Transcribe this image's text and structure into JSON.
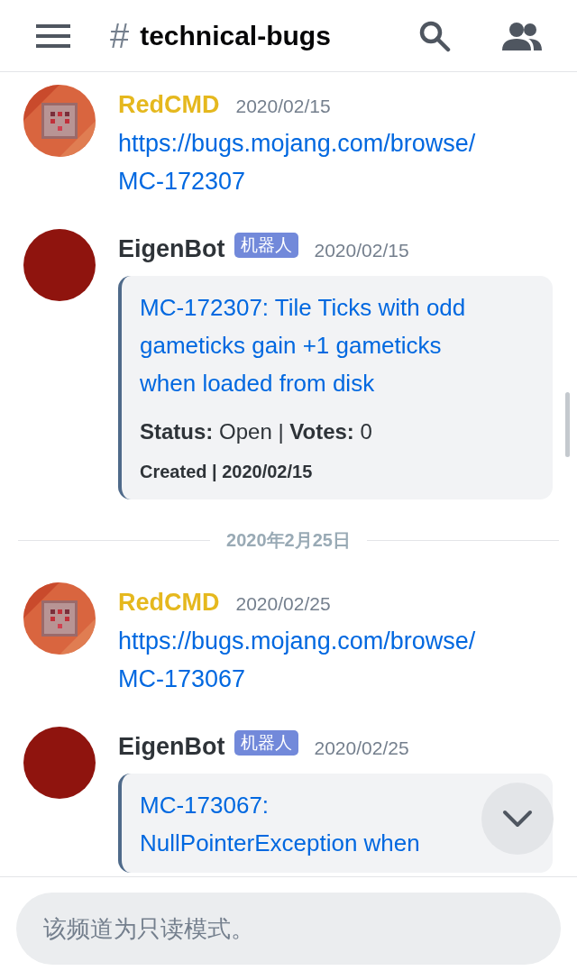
{
  "header": {
    "hash": "#",
    "title": "technical-bugs"
  },
  "messages": [
    {
      "kind": "message",
      "author": "RedCMD",
      "color": "#e5b81e",
      "timestamp": "2020/02/15",
      "link": "https://bugs.mojang.com/browse/MC-172307"
    },
    {
      "kind": "message",
      "avatar": {
        "kind": "plain"
      },
      "author": "EigenBot",
      "color": "#2e3338",
      "tag": "机器人",
      "timestamp": "2020/02/15",
      "embed": {
        "title": "MC-172307: Tile Ticks with odd gameticks gain +1 gameticks when loaded from disk",
        "fields": "**Status:** Open | **Votes:** 0",
        "footer": "Created | 2020/02/15"
      }
    },
    {
      "kind": "divider",
      "label": "2020年2月25日"
    },
    {
      "kind": "message",
      "author": "RedCMD",
      "color": "#e5b81e",
      "timestamp": "2020/02/25",
      "link": "https://bugs.mojang.com/browse/MC-173067"
    },
    {
      "kind": "message",
      "avatar": {
        "kind": "plain"
      },
      "author": "EigenBot",
      "color": "#2e3338",
      "tag": "机器人",
      "timestamp": "2020/02/25",
      "embed": {
        "title": "MC-173067: NullPointerException when"
      }
    }
  ],
  "composer": {
    "placeholder": "该频道为只读模式。"
  }
}
